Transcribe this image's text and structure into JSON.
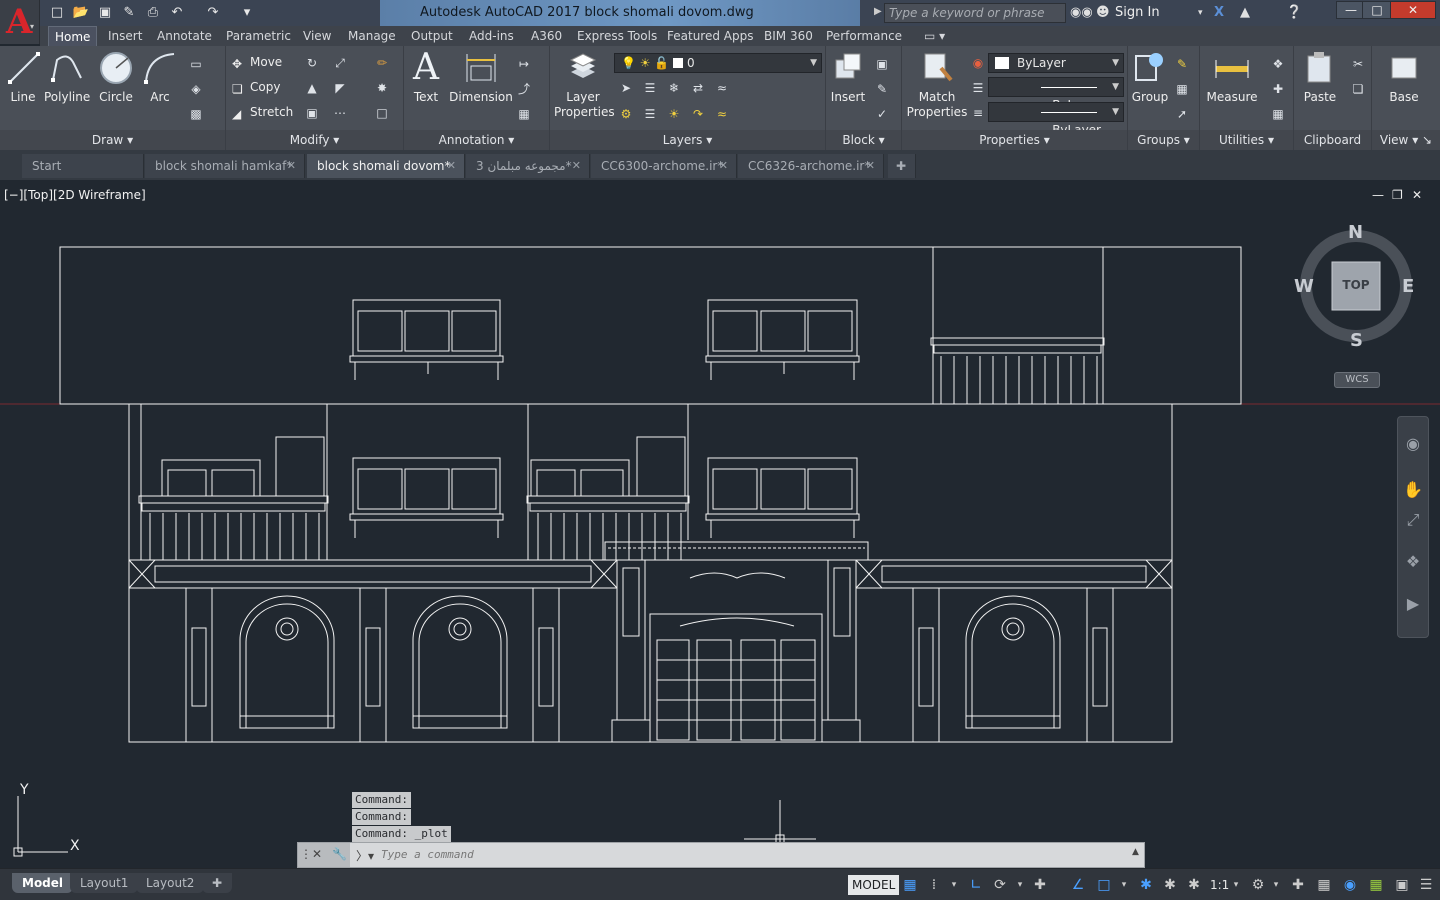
{
  "window": {
    "app_letter": "A",
    "title": "Autodesk AutoCAD 2017   block shomali dovom.dwg",
    "search_placeholder": "Type a keyword or phrase",
    "sign_in": "Sign In"
  },
  "ribbon_tabs": [
    "Home",
    "Insert",
    "Annotate",
    "Parametric",
    "View",
    "Manage",
    "Output",
    "Add-ins",
    "A360",
    "Express Tools",
    "Featured Apps",
    "BIM 360",
    "Performance"
  ],
  "panels": {
    "draw": {
      "title": "Draw",
      "line": "Line",
      "polyline": "Polyline",
      "circle": "Circle",
      "arc": "Arc"
    },
    "modify": {
      "title": "Modify",
      "move": "Move",
      "copy": "Copy",
      "stretch": "Stretch"
    },
    "annotation": {
      "title": "Annotation",
      "text": "Text",
      "dimension": "Dimension"
    },
    "layers": {
      "title": "Layers",
      "layer_properties_1": "Layer",
      "layer_properties_2": "Properties",
      "current_layer": "0"
    },
    "block": {
      "title": "Block",
      "insert": "Insert"
    },
    "properties": {
      "title": "Properties",
      "match_1": "Match",
      "match_2": "Properties",
      "color": "ByLayer",
      "linetype": "ByLayer",
      "lineweight": "ByLayer"
    },
    "groups": {
      "title": "Groups",
      "group": "Group"
    },
    "utilities": {
      "title": "Utilities",
      "measure": "Measure"
    },
    "clipboard": {
      "title": "Clipboard",
      "paste": "Paste"
    },
    "view": {
      "title": "View",
      "base": "Base"
    }
  },
  "doc_tabs": [
    {
      "label": "Start",
      "active": false
    },
    {
      "label": "block shomali hamkaf*",
      "active": false
    },
    {
      "label": "block shomali dovom*",
      "active": true
    },
    {
      "label": "3 مجموعه مبلمان*",
      "active": false
    },
    {
      "label": "CC6300-archome.ir*",
      "active": false
    },
    {
      "label": "CC6326-archome.ir*",
      "active": false
    }
  ],
  "viewport": {
    "label": "[−][Top][2D Wireframe]"
  },
  "viewcube": {
    "n": "N",
    "s": "S",
    "e": "E",
    "w": "W",
    "face": "TOP",
    "wcs": "WCS"
  },
  "ucs": {
    "x": "X",
    "y": "Y"
  },
  "command": {
    "history": [
      "Command:",
      "Command:",
      "Command: _plot"
    ],
    "placeholder": "Type a command"
  },
  "layout_tabs": [
    "Model",
    "Layout1",
    "Layout2"
  ],
  "status": {
    "model": "MODEL",
    "scale": "1:1"
  },
  "colors": {
    "title_bar": "#3b4453",
    "ribbon": "#4a4f57",
    "canvas": "#212830",
    "accent": "#4aa0ff",
    "logo_red": "#d9252b"
  }
}
